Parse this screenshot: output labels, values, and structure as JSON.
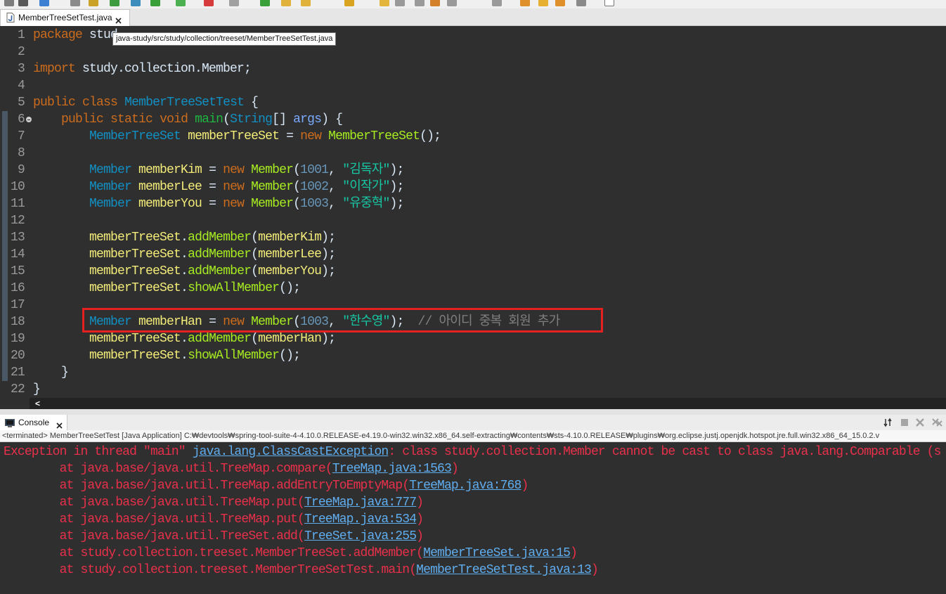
{
  "colors": {
    "editor_bg": "#2f2f2f",
    "console_bg": "#2f2f2f",
    "plain_text": "#d9e8f7",
    "line_number": "#9a9a9a",
    "highlight_border": "#e52020"
  },
  "toolbar": {
    "icons": [
      {
        "name": "new-icon",
        "color": "#7d7d7d"
      },
      {
        "name": "new-dropdown-icon",
        "color": "#5a5a5a"
      },
      {
        "name": "open-type-icon",
        "color": "#3d7fd1"
      },
      {
        "name": "save-icon",
        "color": "#8a8a8a"
      },
      {
        "name": "save-all-icon",
        "color": "#c9a227"
      },
      {
        "name": "debug-icon",
        "color": "#3f9b3f"
      },
      {
        "name": "run-dropdown-icon",
        "color": "#3c8dbc"
      },
      {
        "name": "external-tools-icon",
        "color": "#3aa13a"
      },
      {
        "name": "coverage-icon",
        "color": "#4caf50"
      },
      {
        "name": "toggle-breakpoint-icon",
        "color": "#d63c3c"
      },
      {
        "name": "skip-breakpoints-icon",
        "color": "#a0a0a0"
      },
      {
        "name": "run-icon",
        "color": "#3aa13a"
      },
      {
        "name": "new-java-project-icon",
        "color": "#e0b23a"
      },
      {
        "name": "new-package-icon",
        "color": "#e0b23a"
      },
      {
        "name": "new-class-icon",
        "color": "#d9a520"
      },
      {
        "name": "search-icon",
        "color": "#e3b53a"
      },
      {
        "name": "open-task-icon",
        "color": "#9a9a9a"
      },
      {
        "name": "toggle-mark-occurrences-icon",
        "color": "#9a9a9a"
      },
      {
        "name": "annotation-icon",
        "color": "#d47f2a"
      },
      {
        "name": "word-wrap-icon",
        "color": "#9a9a9a"
      },
      {
        "name": "show-whitespace-icon",
        "color": "#9a9a9a"
      },
      {
        "name": "back-icon",
        "color": "#e0902a"
      },
      {
        "name": "last-edit-location-icon",
        "color": "#e8b030"
      },
      {
        "name": "forward-icon",
        "color": "#e0902a"
      },
      {
        "name": "next-annotation-icon",
        "color": "#8a8a8a"
      },
      {
        "name": "maximize-icon",
        "color": "#ffffff"
      }
    ]
  },
  "editor_tab": {
    "label": "MemberTreeSetTest.java",
    "file_icon": "java-file-icon",
    "close_icon": "close-icon",
    "tooltip": "java-study/src/study/collection/treeset/MemberTreeSetTest.java"
  },
  "editor": {
    "scroll_left_glyph": "<",
    "lines": [
      {
        "n": 1,
        "tokens": [
          [
            "package",
            "#cc6c1d"
          ],
          [
            " stud"
          ]
        ]
      },
      {
        "n": 2,
        "tokens": []
      },
      {
        "n": 3,
        "tokens": [
          [
            "import",
            "#cc6c1d"
          ],
          [
            " study.collection.Member;"
          ]
        ]
      },
      {
        "n": 4,
        "tokens": []
      },
      {
        "n": 5,
        "tokens": [
          [
            "public",
            "#cc6c1d"
          ],
          [
            " "
          ],
          [
            "class",
            "#cc6c1d"
          ],
          [
            " "
          ],
          [
            "MemberTreeSetTest",
            "#1290c3"
          ],
          [
            " {"
          ]
        ]
      },
      {
        "n": 6,
        "fold": true,
        "tokens": [
          [
            "    "
          ],
          [
            "public",
            "#cc6c1d"
          ],
          [
            " "
          ],
          [
            "static",
            "#cc6c1d"
          ],
          [
            " "
          ],
          [
            "void",
            "#cc6c1d"
          ],
          [
            " "
          ],
          [
            "main",
            "#1eb540"
          ],
          [
            "("
          ],
          [
            "String",
            "#1290c3"
          ],
          [
            "[] "
          ],
          [
            "args",
            "#79abff"
          ],
          [
            ") {"
          ]
        ]
      },
      {
        "n": 7,
        "tokens": [
          [
            "        "
          ],
          [
            "MemberTreeSet",
            "#1290c3"
          ],
          [
            " "
          ],
          [
            "memberTreeSet",
            "#f3ec79"
          ],
          [
            " = "
          ],
          [
            "new",
            "#cc6c1d"
          ],
          [
            " "
          ],
          [
            "MemberTreeSet",
            "#a7ec21"
          ],
          [
            "();"
          ]
        ]
      },
      {
        "n": 8,
        "tokens": []
      },
      {
        "n": 9,
        "tokens": [
          [
            "        "
          ],
          [
            "Member",
            "#1290c3"
          ],
          [
            " "
          ],
          [
            "memberKim",
            "#f3ec79"
          ],
          [
            " = "
          ],
          [
            "new",
            "#cc6c1d"
          ],
          [
            " "
          ],
          [
            "Member",
            "#a7ec21"
          ],
          [
            "("
          ],
          [
            "1001",
            "#6897bb"
          ],
          [
            ", "
          ],
          [
            "\"김독자\"",
            "#17c6a3"
          ],
          [
            ");"
          ]
        ]
      },
      {
        "n": 10,
        "tokens": [
          [
            "        "
          ],
          [
            "Member",
            "#1290c3"
          ],
          [
            " "
          ],
          [
            "memberLee",
            "#f3ec79"
          ],
          [
            " = "
          ],
          [
            "new",
            "#cc6c1d"
          ],
          [
            " "
          ],
          [
            "Member",
            "#a7ec21"
          ],
          [
            "("
          ],
          [
            "1002",
            "#6897bb"
          ],
          [
            ", "
          ],
          [
            "\"이작가\"",
            "#17c6a3"
          ],
          [
            ");"
          ]
        ]
      },
      {
        "n": 11,
        "tokens": [
          [
            "        "
          ],
          [
            "Member",
            "#1290c3"
          ],
          [
            " "
          ],
          [
            "memberYou",
            "#f3ec79"
          ],
          [
            " = "
          ],
          [
            "new",
            "#cc6c1d"
          ],
          [
            " "
          ],
          [
            "Member",
            "#a7ec21"
          ],
          [
            "("
          ],
          [
            "1003",
            "#6897bb"
          ],
          [
            ", "
          ],
          [
            "\"유중혁\"",
            "#17c6a3"
          ],
          [
            ");"
          ]
        ]
      },
      {
        "n": 12,
        "tokens": []
      },
      {
        "n": 13,
        "tokens": [
          [
            "        "
          ],
          [
            "memberTreeSet",
            "#f3ec79"
          ],
          [
            "."
          ],
          [
            "addMember",
            "#a7ec21"
          ],
          [
            "("
          ],
          [
            "memberKim",
            "#f3ec79"
          ],
          [
            ");"
          ]
        ]
      },
      {
        "n": 14,
        "tokens": [
          [
            "        "
          ],
          [
            "memberTreeSet",
            "#f3ec79"
          ],
          [
            "."
          ],
          [
            "addMember",
            "#a7ec21"
          ],
          [
            "("
          ],
          [
            "memberLee",
            "#f3ec79"
          ],
          [
            ");"
          ]
        ]
      },
      {
        "n": 15,
        "tokens": [
          [
            "        "
          ],
          [
            "memberTreeSet",
            "#f3ec79"
          ],
          [
            "."
          ],
          [
            "addMember",
            "#a7ec21"
          ],
          [
            "("
          ],
          [
            "memberYou",
            "#f3ec79"
          ],
          [
            ");"
          ]
        ]
      },
      {
        "n": 16,
        "tokens": [
          [
            "        "
          ],
          [
            "memberTreeSet",
            "#f3ec79"
          ],
          [
            "."
          ],
          [
            "showAllMember",
            "#a7ec21"
          ],
          [
            "();"
          ]
        ]
      },
      {
        "n": 17,
        "tokens": []
      },
      {
        "n": 18,
        "tokens": [
          [
            "        "
          ],
          [
            "Member",
            "#1290c3"
          ],
          [
            " "
          ],
          [
            "memberHan",
            "#f3ec79"
          ],
          [
            " = "
          ],
          [
            "new",
            "#cc6c1d"
          ],
          [
            " "
          ],
          [
            "Member",
            "#a7ec21"
          ],
          [
            "("
          ],
          [
            "1003",
            "#6897bb"
          ],
          [
            ", "
          ],
          [
            "\"한수영\"",
            "#17c6a3"
          ],
          [
            ");  "
          ],
          [
            "// 아이디 중복 회원 추가",
            "#808080"
          ]
        ]
      },
      {
        "n": 19,
        "tokens": [
          [
            "        "
          ],
          [
            "memberTreeSet",
            "#f3ec79"
          ],
          [
            "."
          ],
          [
            "addMember",
            "#a7ec21"
          ],
          [
            "("
          ],
          [
            "memberHan",
            "#f3ec79"
          ],
          [
            ");"
          ]
        ]
      },
      {
        "n": 20,
        "tokens": [
          [
            "        "
          ],
          [
            "memberTreeSet",
            "#f3ec79"
          ],
          [
            "."
          ],
          [
            "showAllMember",
            "#a7ec21"
          ],
          [
            "();"
          ]
        ]
      },
      {
        "n": 21,
        "tokens": [
          [
            "    }"
          ]
        ]
      },
      {
        "n": 22,
        "tokens": [
          [
            "}"
          ]
        ]
      }
    ]
  },
  "console": {
    "tab_label": "Console",
    "tab_icon": "console-icon",
    "status": "<terminated> MemberTreeSetTest [Java Application] C:₩devtools₩spring-tool-suite-4-4.10.0.RELEASE-e4.19.0-win32.win32.x86_64.self-extracting₩contents₩sts-4.10.0.RELEASE₩plugins₩org.eclipse.justj.openjdk.hotspot.jre.full.win32.x86_64_15.0.2.v",
    "actions": [
      "display-console-icon",
      "terminate-icon",
      "remove-launch-icon",
      "remove-all-terminated-icon"
    ],
    "lines": [
      [
        [
          "Exception in thread \"main\" ",
          "#e8304a"
        ],
        [
          "java.lang.ClassCastException",
          "#5fadef",
          true
        ],
        [
          ": class study.collection.Member cannot be cast to class java.lang.Comparable (s",
          "#e8304a"
        ]
      ],
      [
        [
          "\tat java.base/java.util.TreeMap.compare(",
          "#e8304a"
        ],
        [
          "TreeMap.java:1563",
          "#5fadef",
          true
        ],
        [
          ")",
          "#e8304a"
        ]
      ],
      [
        [
          "\tat java.base/java.util.TreeMap.addEntryToEmptyMap(",
          "#e8304a"
        ],
        [
          "TreeMap.java:768",
          "#5fadef",
          true
        ],
        [
          ")",
          "#e8304a"
        ]
      ],
      [
        [
          "\tat java.base/java.util.TreeMap.put(",
          "#e8304a"
        ],
        [
          "TreeMap.java:777",
          "#5fadef",
          true
        ],
        [
          ")",
          "#e8304a"
        ]
      ],
      [
        [
          "\tat java.base/java.util.TreeMap.put(",
          "#e8304a"
        ],
        [
          "TreeMap.java:534",
          "#5fadef",
          true
        ],
        [
          ")",
          "#e8304a"
        ]
      ],
      [
        [
          "\tat java.base/java.util.TreeSet.add(",
          "#e8304a"
        ],
        [
          "TreeSet.java:255",
          "#5fadef",
          true
        ],
        [
          ")",
          "#e8304a"
        ]
      ],
      [
        [
          "\tat study.collection.treeset.MemberTreeSet.addMember(",
          "#e8304a"
        ],
        [
          "MemberTreeSet.java:15",
          "#5fadef",
          true
        ],
        [
          ")",
          "#e8304a"
        ]
      ],
      [
        [
          "\tat study.collection.treeset.MemberTreeSetTest.main(",
          "#e8304a"
        ],
        [
          "MemberTreeSetTest.java:13",
          "#5fadef",
          true
        ],
        [
          ")",
          "#e8304a"
        ]
      ]
    ]
  }
}
